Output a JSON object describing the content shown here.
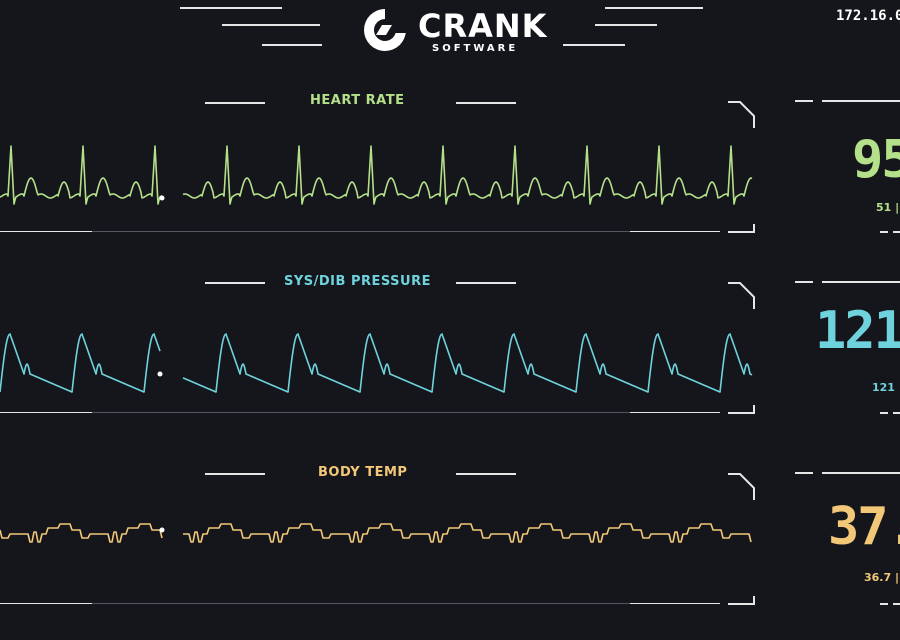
{
  "brand": {
    "name": "CRANK",
    "sub": "SOFTWARE"
  },
  "ip_address": "172.16.0",
  "colors": {
    "heart": "#b5e08a",
    "pressure": "#6fd3dd",
    "temp": "#f2c878",
    "bg": "#15161b"
  },
  "sections": {
    "heart": {
      "title": "HEART RATE",
      "value": "95",
      "sub": "51 |"
    },
    "pressure": {
      "title": "SYS/DIB PRESSURE",
      "value": "121/",
      "sub": "121 |"
    },
    "temp": {
      "title": "BODY TEMP",
      "value": "37.",
      "sub": "36.7 |"
    }
  }
}
